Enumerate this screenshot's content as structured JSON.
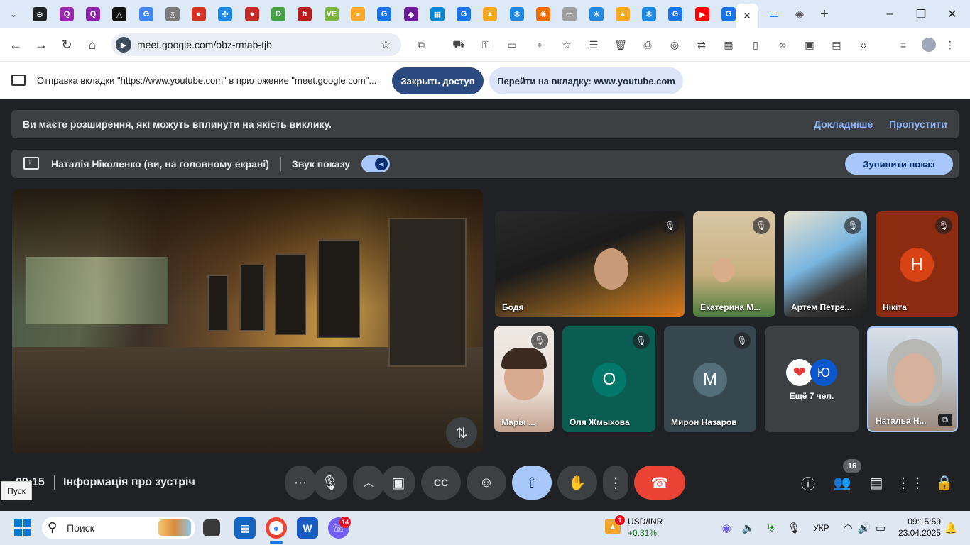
{
  "browser": {
    "url": "meet.google.com/obz-rmab-tjb",
    "active_tab_close": "✕",
    "new_tab": "+",
    "tab_favicons": [
      {
        "icon": "tab-menu-icon",
        "glyph": "⌄",
        "color": "#dee9f7"
      },
      {
        "icon": "app-icon",
        "glyph": "⊖",
        "color": "#202124"
      },
      {
        "icon": "quiz-icon",
        "glyph": "Q",
        "color": "#9c27b0"
      },
      {
        "icon": "quiz-icon",
        "glyph": "Q",
        "color": "#8e24aa"
      },
      {
        "icon": "triangle-app-icon",
        "glyph": "△",
        "color": "#111111"
      },
      {
        "icon": "google-icon",
        "glyph": "G",
        "color": "#4285f4"
      },
      {
        "icon": "globe-icon",
        "glyph": "◎",
        "color": "#7a7a7a"
      },
      {
        "icon": "red-ball-icon",
        "glyph": "●",
        "color": "#d93025"
      },
      {
        "icon": "puzzle-app-icon",
        "glyph": "✣",
        "color": "#1e88e5"
      },
      {
        "icon": "red-ball-icon",
        "glyph": "●",
        "color": "#c62828"
      },
      {
        "icon": "d-app-icon",
        "glyph": "D",
        "color": "#43a047"
      },
      {
        "icon": "fi-app-icon",
        "glyph": "fi",
        "color": "#b71c1c"
      },
      {
        "icon": "ve-app-icon",
        "glyph": "VE",
        "color": "#7cb342"
      },
      {
        "icon": "link-icon",
        "glyph": "⚭",
        "color": "#f9a825"
      },
      {
        "icon": "google-g-icon",
        "glyph": "G",
        "color": "#1a73e8"
      },
      {
        "icon": "chat-app-icon",
        "glyph": "◆",
        "color": "#6a1b9a"
      },
      {
        "icon": "grid-app-icon",
        "glyph": "▦",
        "color": "#0288d1"
      },
      {
        "icon": "google-g-icon",
        "glyph": "G",
        "color": "#1a73e8"
      },
      {
        "icon": "bell-icon",
        "glyph": "▲",
        "color": "#f9a825"
      },
      {
        "icon": "snowflake-icon",
        "glyph": "✻",
        "color": "#1e88e5"
      },
      {
        "icon": "pinwheel-icon",
        "glyph": "✺",
        "color": "#ef6c00"
      },
      {
        "icon": "board-icon",
        "glyph": "▭",
        "color": "#9e9e9e"
      },
      {
        "icon": "snowflake-icon",
        "glyph": "✻",
        "color": "#1e88e5"
      },
      {
        "icon": "bell-icon",
        "glyph": "▲",
        "color": "#f9a825"
      },
      {
        "icon": "snowflake-icon",
        "glyph": "✻",
        "color": "#1e88e5"
      },
      {
        "icon": "google-g-icon",
        "glyph": "G",
        "color": "#1a73e8"
      },
      {
        "icon": "youtube-icon",
        "glyph": "▶",
        "color": "#ff0000"
      },
      {
        "icon": "google-g-icon",
        "glyph": "G",
        "color": "#1a73e8"
      }
    ],
    "after_active_favicons": [
      {
        "icon": "tab-screen-icon",
        "glyph": "▭",
        "color": "#1a73e8"
      },
      {
        "icon": "shield-icon",
        "glyph": "◈",
        "color": "#555555"
      }
    ],
    "window_controls": {
      "minimize": "–",
      "maximize": "❐",
      "close": "✕"
    }
  },
  "infobar": {
    "text": "Отправка вкладки \"https://www.youtube.com\" в приложение \"meet.google.com\"...",
    "stop_button": "Закрыть доступ",
    "switch_button": "Перейти на вкладку: www.youtube.com"
  },
  "warning": {
    "text": "Ви маєте розширення, які можуть вплинути на якість виклику.",
    "learn_more": "Докладніше",
    "skip": "Пропустити"
  },
  "presenting": {
    "presenter": "Наталія Ніколенко (ви, на головному екрані)",
    "sound_label": "Звук показу",
    "stop_button": "Зупинити показ"
  },
  "participants": {
    "row1": [
      {
        "name": "Бодя",
        "muted": true
      },
      {
        "name": "Екатерина М...",
        "muted": true
      },
      {
        "name": "Артем Петре...",
        "muted": true
      },
      {
        "name": "Нікіта",
        "muted": true,
        "initial": "Н",
        "avatar_color": "#d84315"
      }
    ],
    "row2": [
      {
        "name": "Марія ...",
        "muted": true
      },
      {
        "name": "Оля Жмыхова",
        "muted": true,
        "initial": "О",
        "avatar_color": "#00796b"
      },
      {
        "name": "Мирон Назаров",
        "muted": true,
        "initial": "М",
        "avatar_color": "#546e7a"
      },
      {
        "name": "Натальа Н...",
        "muted": false
      }
    ],
    "more": {
      "label": "Ещё 7 чел.",
      "initial": "Ю",
      "avatar_color": "#0b57d0"
    }
  },
  "controls": {
    "clock": "09:15",
    "meeting_info": "Інформація про зустріч",
    "people_count": "16"
  },
  "taskbar": {
    "start_tooltip": "Пуск",
    "search_placeholder": "Поиск",
    "viber_badge": "14",
    "stock_name": "USD/INR",
    "stock_change": "+0.31%",
    "stock_badge": "1",
    "language": "УКР",
    "time": "09:15:59",
    "date": "23.04.2025"
  }
}
